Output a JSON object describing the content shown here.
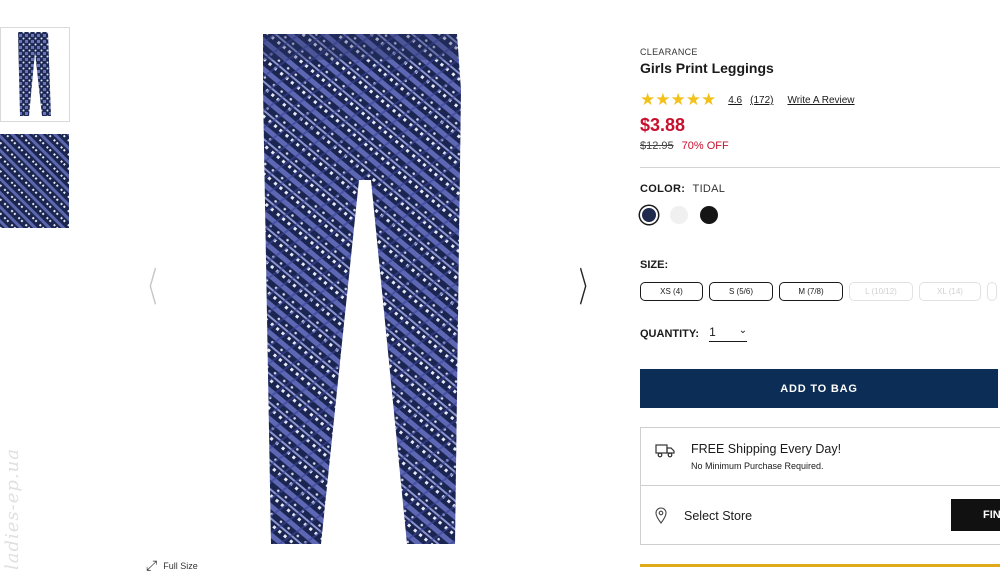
{
  "gallery": {
    "full_size_label": "Full Size",
    "watermark": "ladies-ep.ua",
    "prev_arrow": "〈",
    "next_arrow": "〉",
    "fullsize_icon": "expand-icon"
  },
  "product": {
    "tag": "CLEARANCE",
    "title": "Girls Print Leggings",
    "rating": {
      "stars": "★★★★★",
      "value": "4.6",
      "count": "(172)",
      "write_review": "Write A Review"
    },
    "price": "$3.88",
    "was_price": "$12.95",
    "discount": "70% OFF",
    "color": {
      "label": "COLOR:",
      "value": "TIDAL",
      "swatches": [
        "#1f2a4d",
        "#f0f0f0",
        "#151515"
      ]
    },
    "size": {
      "label": "SIZE:",
      "options": [
        {
          "label": "XS (4)",
          "available": true
        },
        {
          "label": "S (5/6)",
          "available": true
        },
        {
          "label": "M (7/8)",
          "available": true
        },
        {
          "label": "L (10/12)",
          "available": false
        },
        {
          "label": "XL (14)",
          "available": false
        },
        {
          "label": "",
          "available": false
        }
      ]
    },
    "quantity": {
      "label": "QUANTITY:",
      "value": "1",
      "chevron": "⌄"
    },
    "add_to_bag": "ADD TO BAG",
    "shipping": {
      "title": "FREE Shipping Every Day!",
      "subtitle": "No Minimum Purchase Required."
    },
    "store": {
      "label": "Select Store",
      "find_button": "FIN"
    }
  },
  "colors": {
    "brand_navy": "#0c2d55",
    "sale_red": "#c8102e",
    "star_gold": "#f2c21b",
    "accent_gold": "#e0a918"
  }
}
